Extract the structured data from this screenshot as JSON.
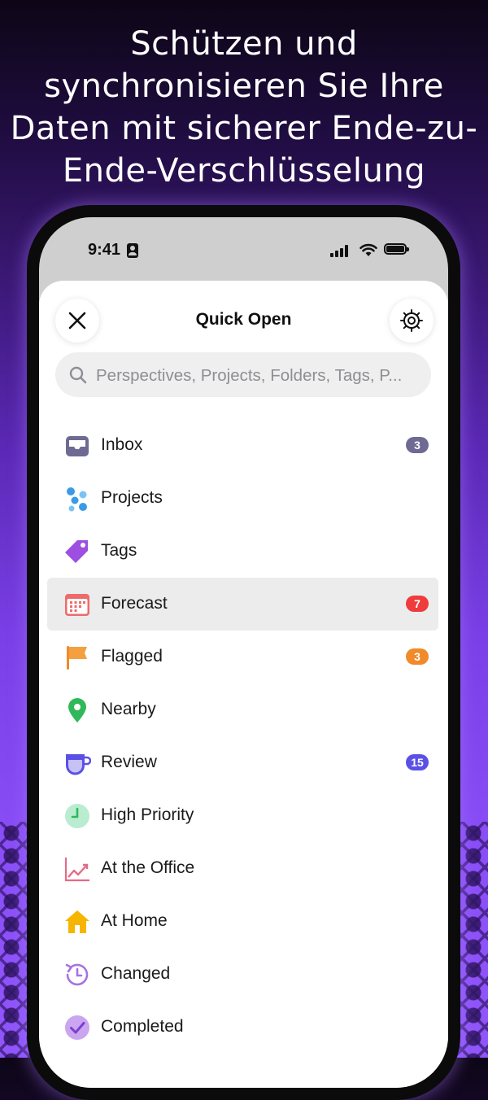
{
  "headline": "Schützen und synchronisieren Sie Ihre Daten mit sicherer Ende-zu-Ende-Verschlüsselung",
  "status_bar": {
    "time": "9:41"
  },
  "sheet": {
    "title": "Quick Open",
    "close_icon": "close-icon",
    "settings_icon": "gear-icon"
  },
  "search": {
    "placeholder": "Perspectives, Projects, Folders, Tags, P..."
  },
  "colors": {
    "inbox_badge": "#6e6a94",
    "forecast_badge": "#ef3b3b",
    "flagged_badge": "#f08a2a",
    "review_badge": "#5b50e6"
  },
  "items": [
    {
      "label": "Inbox",
      "icon": "inbox-icon",
      "badge": "3"
    },
    {
      "label": "Projects",
      "icon": "projects-icon"
    },
    {
      "label": "Tags",
      "icon": "tag-icon"
    },
    {
      "label": "Forecast",
      "icon": "calendar-icon",
      "badge": "7",
      "selected": true
    },
    {
      "label": "Flagged",
      "icon": "flag-icon",
      "badge": "3"
    },
    {
      "label": "Nearby",
      "icon": "location-pin-icon"
    },
    {
      "label": "Review",
      "icon": "review-cup-icon",
      "badge": "15"
    },
    {
      "label": "High Priority",
      "icon": "clock-icon"
    },
    {
      "label": "At the Office",
      "icon": "chart-icon"
    },
    {
      "label": "At Home",
      "icon": "home-icon"
    },
    {
      "label": "Changed",
      "icon": "history-icon"
    },
    {
      "label": "Completed",
      "icon": "checkmark-icon"
    }
  ]
}
